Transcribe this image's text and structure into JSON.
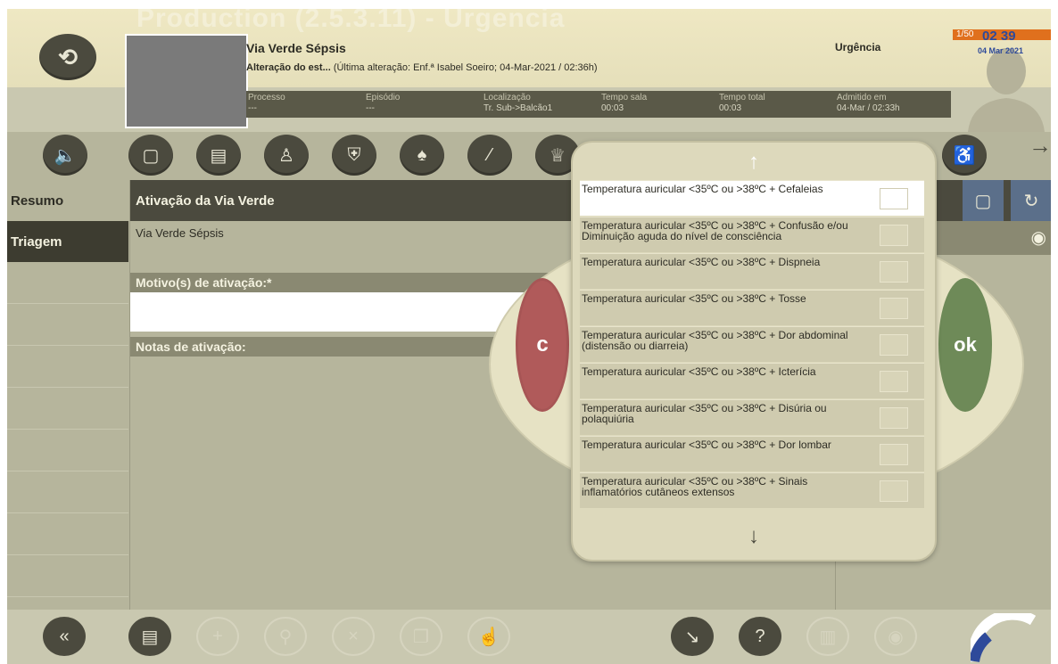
{
  "header": {
    "watermark": "Production (2.5.3.11) - Urgencia",
    "patient_name": "Via Verde Sépsis",
    "status_strong": "Alteração do est...",
    "status_rest": "(Última alteração: Enf.ª Isabel Soeiro; 04-Mar-2021 / 02:36h)",
    "type": "Urgência",
    "counter": "1/50",
    "info": [
      {
        "label": "Processo",
        "value": "---"
      },
      {
        "label": "Episódio",
        "value": "---"
      },
      {
        "label": "Localização",
        "value": "Tr. Sub->Balcão1"
      },
      {
        "label": "Tempo sala",
        "value": "00:03"
      },
      {
        "label": "Tempo total",
        "value": "00:03"
      },
      {
        "label": "Admitido em",
        "value": "04-Mar / 02:33h"
      }
    ]
  },
  "nav": {
    "resumo": "Resumo",
    "triagem": "Triagem"
  },
  "main": {
    "title": "Ativação da Via Verde",
    "subtitle": "Via Verde Sépsis",
    "motivo_label": "Motivo(s) de ativação:*",
    "notas_label": "Notas de ativação:"
  },
  "popup": {
    "cancel": "c",
    "ok": "ok",
    "options": [
      "Temperatura auricular <35ºC ou >38ºC + Cefaleias",
      "Temperatura auricular <35ºC ou >38ºC + Confusão e/ou Diminuição aguda do nível de consciência",
      "Temperatura auricular <35ºC ou >38ºC + Dispneia",
      "Temperatura auricular <35ºC ou >38ºC + Tosse",
      "Temperatura auricular <35ºC ou >38ºC + Dor abdominal (distensão ou diarreia)",
      "Temperatura auricular <35ºC ou >38ºC + Icterícia",
      "Temperatura auricular <35ºC ou >38ºC + Disúria ou polaquiúria",
      "Temperatura auricular <35ºC ou >38ºC + Dor lombar",
      "Temperatura auricular <35ºC ou >38ºC + Sinais inflamatórios cutâneos extensos"
    ]
  },
  "clock": {
    "time": "02 39",
    "date": "04 Mar 2021"
  },
  "colors": {
    "panel": "#b6b59c",
    "dark": "#4b4a3e",
    "cancel": "#b05a5a",
    "ok": "#6e8a58",
    "counter": "#e0701d"
  }
}
